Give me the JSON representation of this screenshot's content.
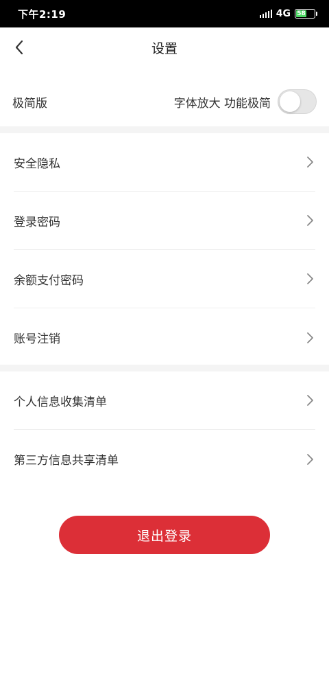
{
  "status_bar": {
    "time": "下午2:19",
    "network": "4G",
    "battery": "58"
  },
  "nav": {
    "title": "设置"
  },
  "simple_mode": {
    "label": "极简版",
    "description": "字体放大 功能极简",
    "enabled": false
  },
  "settings_group_1": {
    "items": [
      {
        "label": "安全隐私"
      },
      {
        "label": "登录密码"
      },
      {
        "label": "余额支付密码"
      },
      {
        "label": "账号注销"
      }
    ]
  },
  "settings_group_2": {
    "items": [
      {
        "label": "个人信息收集清单"
      },
      {
        "label": "第三方信息共享清单"
      }
    ]
  },
  "logout": {
    "label": "退出登录"
  },
  "colors": {
    "accent": "#dc2f37",
    "battery": "#4cd964",
    "divider": "#f4f4f4"
  }
}
